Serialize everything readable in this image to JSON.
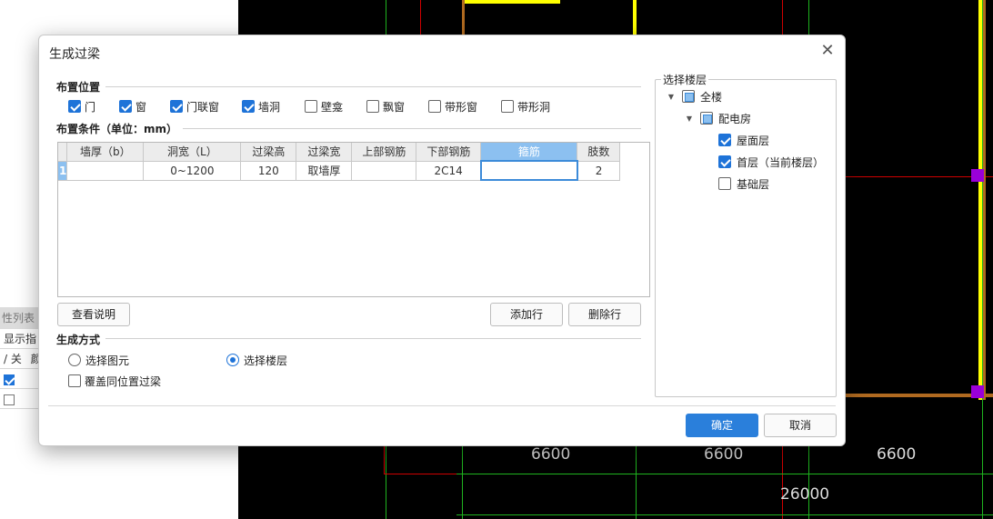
{
  "background": {
    "props_panel": {
      "header": "性列表",
      "row1": "显示指",
      "row2": "/ 关",
      "row2_extra": "颜",
      "row3_checked": true,
      "row4_checked": false
    },
    "cad": {
      "dims": [
        "6600",
        "6600",
        "6600",
        "26000"
      ],
      "colors": {
        "grid": "#1fb41f",
        "yellow": "#ffff00",
        "brown": "#b06a20",
        "magenta": "#9a00d8",
        "red": "#d00000"
      }
    }
  },
  "dialog": {
    "title": "生成过梁",
    "close_icon": "close-icon",
    "placement": {
      "label": "布置位置",
      "options": [
        {
          "label": "门",
          "checked": true
        },
        {
          "label": "窗",
          "checked": true
        },
        {
          "label": "门联窗",
          "checked": true
        },
        {
          "label": "墙洞",
          "checked": true
        },
        {
          "label": "壁龛",
          "checked": false
        },
        {
          "label": "飘窗",
          "checked": false
        },
        {
          "label": "带形窗",
          "checked": false
        },
        {
          "label": "带形洞",
          "checked": false
        }
      ]
    },
    "conditions": {
      "label": "布置条件（单位：mm）",
      "columns": [
        "墙厚（b）",
        "洞宽（L）",
        "过梁高",
        "过梁宽",
        "上部钢筋",
        "下部钢筋",
        "箍筋",
        "肢数"
      ],
      "active_column": 6,
      "rows": [
        {
          "num": "1",
          "cells": [
            "",
            "0~1200",
            "120",
            "取墙厚",
            "",
            "2C14",
            "",
            "2"
          ]
        }
      ]
    },
    "buttons": {
      "view_notes": "查看说明",
      "add_row": "添加行",
      "delete_row": "删除行",
      "ok": "确定",
      "cancel": "取消"
    },
    "generation": {
      "label": "生成方式",
      "radio_select_element": "选择图元",
      "radio_select_floor": "选择楼层",
      "selected": "floor",
      "overwrite_label": "覆盖同位置过梁",
      "overwrite_checked": false
    },
    "floors": {
      "label": "选择楼层",
      "tree": [
        {
          "label": "全楼",
          "level": 0,
          "state": "partial",
          "expanded": true
        },
        {
          "label": "配电房",
          "level": 1,
          "state": "partial",
          "expanded": true
        },
        {
          "label": "屋面层",
          "level": 2,
          "state": "checked"
        },
        {
          "label": "首层（当前楼层）",
          "level": 2,
          "state": "checked"
        },
        {
          "label": "基础层",
          "level": 2,
          "state": "unchecked"
        }
      ]
    }
  }
}
